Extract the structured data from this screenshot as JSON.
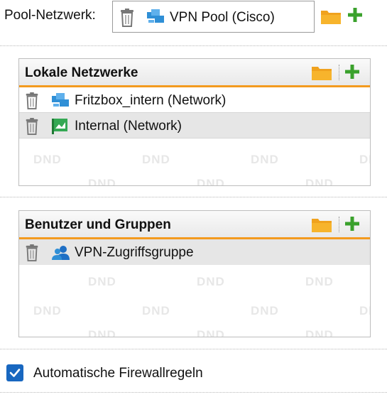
{
  "pool": {
    "label": "Pool-Netzwerk:",
    "value": "VPN Pool (Cisco)",
    "value_icon": "network-blue-icon"
  },
  "panels": {
    "local": {
      "title": "Lokale Netzwerke",
      "items": [
        {
          "label": "Fritzbox_intern (Network)",
          "icon": "network-blue-icon"
        },
        {
          "label": "Internal (Network)",
          "icon": "network-green-icon"
        }
      ]
    },
    "users": {
      "title": "Benutzer und Gruppen",
      "items": [
        {
          "label": "VPN-Zugriffsgruppe",
          "icon": "user-group-icon"
        }
      ]
    }
  },
  "watermark": "DND",
  "firewall": {
    "checked": true,
    "label": "Automatische Firewallregeln"
  },
  "colors": {
    "accent_orange": "#f39a1e",
    "plus_green": "#3aa12c",
    "checkbox_blue": "#1867c0",
    "network_blue": "#2f8fd6",
    "network_green": "#34a853"
  }
}
